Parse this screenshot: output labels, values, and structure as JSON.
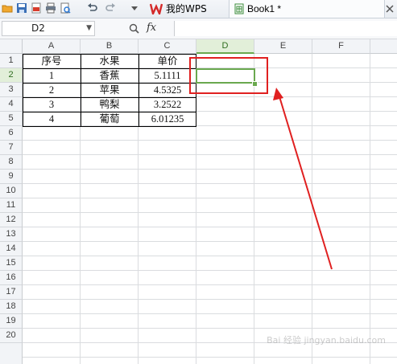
{
  "toolbar": {
    "tabs": [
      {
        "label": "我的WPS",
        "icon": "wps-logo-icon"
      },
      {
        "label": "Book1 *",
        "icon": "spreadsheet-doc-icon"
      }
    ],
    "quick_access_icons": [
      "open-folder-icon",
      "save-icon",
      "export-pdf-icon",
      "print-icon",
      "print-preview-icon",
      "undo-icon",
      "redo-icon",
      "customize-dropdown-icon"
    ]
  },
  "formula_bar": {
    "name_box": "D2",
    "fx_label": "fx",
    "formula": ""
  },
  "sheet": {
    "columns": [
      "A",
      "B",
      "C",
      "D",
      "E",
      "F"
    ],
    "selected_column": "D",
    "rows": [
      "1",
      "2",
      "3",
      "4",
      "5",
      "6",
      "7",
      "8",
      "9",
      "10",
      "11",
      "12",
      "13",
      "14",
      "15",
      "16",
      "17",
      "18",
      "19",
      "20"
    ],
    "selected_row": "2",
    "active_cell": "D2",
    "cells": [
      [
        "序号",
        "水果",
        "单价"
      ],
      [
        "1",
        "香蕉",
        "5.1111"
      ],
      [
        "2",
        "苹果",
        "4.5325"
      ],
      [
        "3",
        "鸭梨",
        "3.2522"
      ],
      [
        "4",
        "葡萄",
        "6.01235"
      ]
    ]
  },
  "annotation": {
    "color": "#e02020",
    "target": "D2"
  },
  "watermark": "Bai 经验 jingyan.baidu.com",
  "colors": {
    "selection": "#6aa84f",
    "annotation": "#e02020"
  }
}
